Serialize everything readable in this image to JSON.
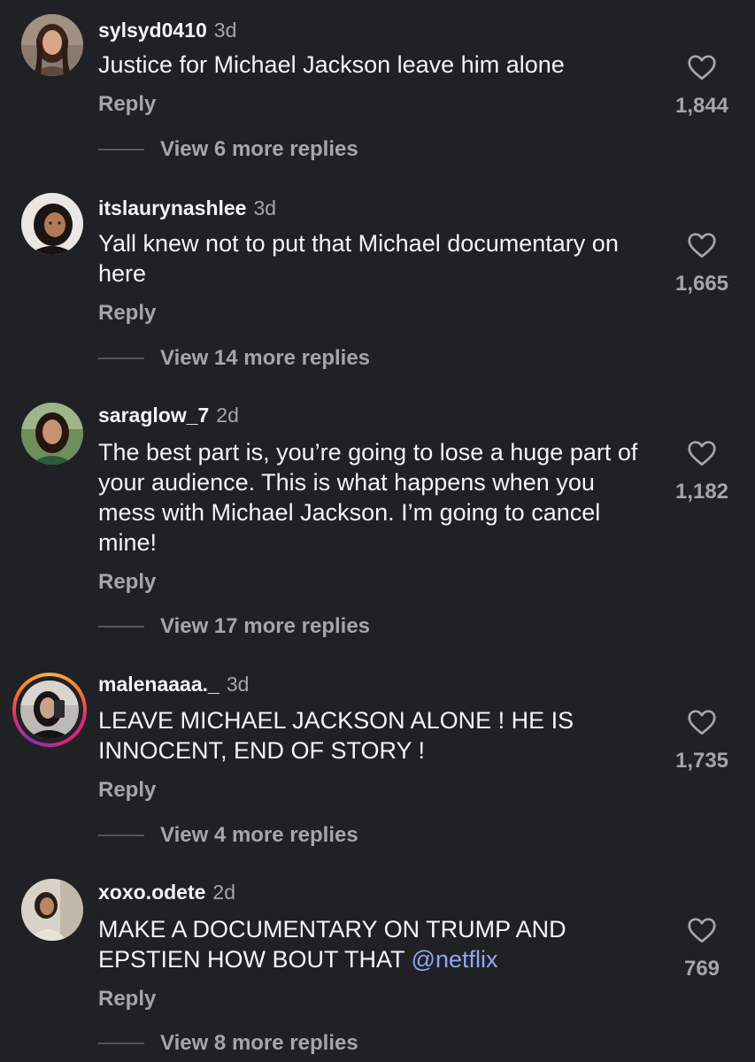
{
  "comments": [
    {
      "username": "sylsyd0410",
      "time": "3d",
      "text": "Justice for Michael Jackson leave him alone",
      "reply_label": "Reply",
      "view_replies": "View 6 more replies",
      "likes": "1,844",
      "avatar_icon": "profile-photo"
    },
    {
      "username": "itslaurynashlee",
      "time": "3d",
      "text": "Yall knew not to put that Michael documentary on here",
      "reply_label": "Reply",
      "view_replies": "View 14 more replies",
      "likes": "1,665",
      "avatar_icon": "profile-photo"
    },
    {
      "username": "saraglow_7",
      "time": "2d",
      "text": "The best part is, you’re going to lose a huge part of your audience. This is what happens when you mess with Michael Jackson. I’m going to cancel mine!",
      "reply_label": "Reply",
      "view_replies": "View 17 more replies",
      "likes": "1,182",
      "avatar_icon": "profile-photo"
    },
    {
      "username": "malenaaaa._",
      "time": "3d",
      "text": "LEAVE MICHAEL JACKSON ALONE ! HE IS INNOCENT,  END OF STORY !",
      "reply_label": "Reply",
      "view_replies": "View 4 more replies",
      "likes": "1,735",
      "avatar_icon": "profile-photo-with-story-ring"
    },
    {
      "username": "xoxo.odete",
      "time": "2d",
      "text_before_mention": "MAKE A DOCUMENTARY ON TRUMP AND EPSTIEN HOW BOUT THAT ",
      "mention": "@netflix",
      "reply_label": "Reply",
      "view_replies": "View 8 more replies",
      "likes": "769",
      "avatar_icon": "profile-photo"
    }
  ],
  "colors": {
    "background": "#202124",
    "primary_text": "#f4f4f4",
    "secondary_text": "#a4a6aa",
    "mention": "#8fa7f5",
    "story_ring": [
      "#f6b33c",
      "#f58529",
      "#dd2a7b",
      "#8134af"
    ]
  },
  "icons": {
    "like": "heart-outline-icon"
  }
}
